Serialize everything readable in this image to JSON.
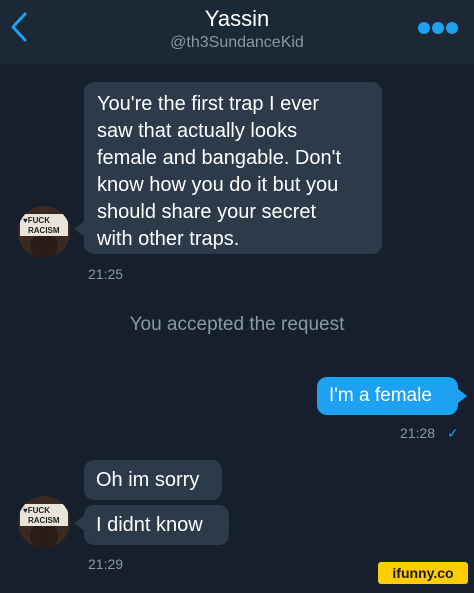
{
  "header": {
    "name": "Yassin",
    "handle": "@th3SundanceKid",
    "back_icon": "chevron-left-icon",
    "more_icon": "more-dots-icon"
  },
  "messages": {
    "m1": {
      "text": "You're the first trap I ever\nsaw that actually looks\nfemale and bangable. Don't\nknow how you do it but you\nshould share your secret\nwith other traps.",
      "time": "21:25"
    },
    "system": "You accepted the request",
    "m2": {
      "text": "I'm a female",
      "time": "21:28",
      "status": "✓"
    },
    "m3": {
      "text": "Oh im sorry"
    },
    "m4": {
      "text": "I didnt know",
      "time": "21:29"
    }
  },
  "avatar": {
    "sign_text": "FUCK RACISM"
  },
  "watermark": "ifunny.co",
  "colors": {
    "background": "#16202c",
    "header": "#1b2836",
    "bubble_received": "#2c3a4a",
    "bubble_sent": "#1da1f2",
    "accent": "#1da1f2",
    "meta_text": "#8899a6"
  }
}
